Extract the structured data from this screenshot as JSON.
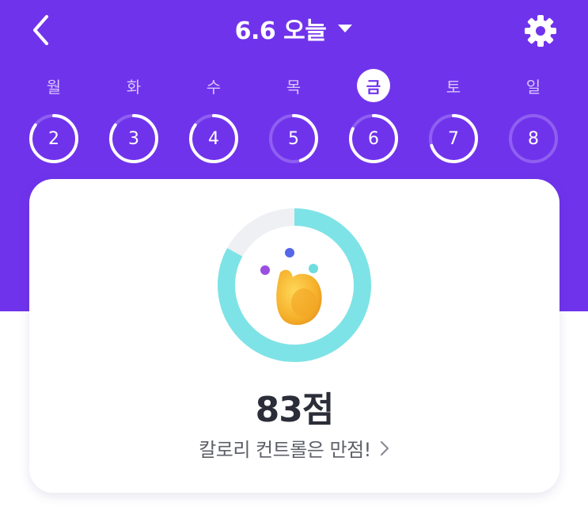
{
  "header": {
    "title": "6.6 오늘",
    "back_icon": "chevron-left-icon",
    "dropdown_icon": "caret-down-icon",
    "settings_icon": "gear-icon"
  },
  "colors": {
    "primary": "#7033ec",
    "ring_accent": "#7ee3e6",
    "ring_track": "#eef0f4",
    "text_dark": "#2b2d38",
    "text_sub": "#5e6068"
  },
  "week": {
    "weekdays": [
      "월",
      "화",
      "수",
      "목",
      "금",
      "토",
      "일"
    ],
    "selected_index": 4,
    "days": [
      {
        "num": "2",
        "progress": 0.85
      },
      {
        "num": "3",
        "progress": 0.85
      },
      {
        "num": "4",
        "progress": 0.85
      },
      {
        "num": "5",
        "progress": 0.45
      },
      {
        "num": "6",
        "progress": 0.82
      },
      {
        "num": "7",
        "progress": 0.7
      },
      {
        "num": "8",
        "progress": 0.0
      }
    ]
  },
  "summary": {
    "score_label": "83점",
    "score_progress": 0.83,
    "message": "칼로리 컨트롤은 만점!",
    "message_icon": "chevron-right-icon",
    "mascot": "mascot-icon"
  }
}
